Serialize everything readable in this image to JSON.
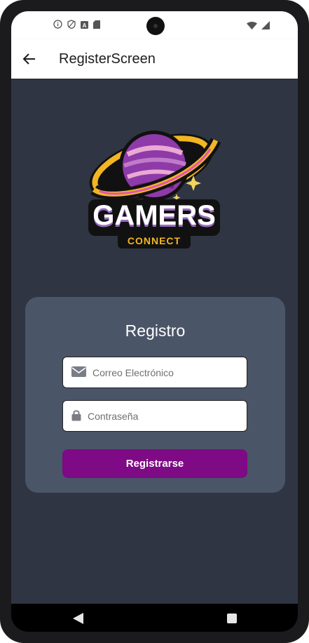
{
  "appbar": {
    "title": "RegisterScreen"
  },
  "logo": {
    "main_text": "GAMERS",
    "sub_text": "CONNECT"
  },
  "card": {
    "title": "Registro",
    "email_placeholder": "Correo Electrónico",
    "password_placeholder": "Contraseña",
    "submit_label": "Registrarse"
  },
  "colors": {
    "background": "#2f3542",
    "card": "#4a5568",
    "button": "#7e0a85"
  },
  "icons": [
    "info-icon",
    "shield-icon",
    "a-icon",
    "sd-card-icon",
    "wifi-icon",
    "signal-icon",
    "back-arrow-icon",
    "mail-icon",
    "lock-icon",
    "nav-back-icon",
    "nav-home-icon"
  ]
}
